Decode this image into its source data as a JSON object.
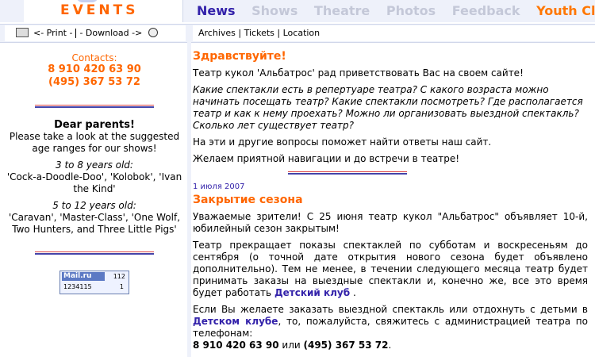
{
  "brand": {
    "title": "EVENTS"
  },
  "nav": {
    "news": "News",
    "shows": "Shows",
    "theatre": "Theatre",
    "photos": "Photos",
    "feedback": "Feedback",
    "youth_club": "Youth Club"
  },
  "toolbar": {
    "print": "<- Print -",
    "download": "- Download ->",
    "archives": "Archives",
    "tickets": "Tickets",
    "location": "Location",
    "sep": "|"
  },
  "sidebar": {
    "contacts_label": "Contacts:",
    "phone1": "8 910 420 63 90",
    "phone2": "(495) 367 53 72",
    "dear": "Dear parents!",
    "intro": "Please take a look at the suggested age ranges for our shows!",
    "age1": "3 to 8 years old:",
    "shows1": "'Cock-a-Doodle-Doo', 'Kolobok', 'Ivan the Kind'",
    "age2": "5 to 12 years old:",
    "shows2": "'Caravan', 'Master-Class', 'One Wolf, Two Hunters, and Three Little Pigs'",
    "counter_logo": "Mail.ru",
    "counter_n1": "112",
    "counter_n2": "1234115",
    "counter_n3": "1"
  },
  "main": {
    "greet_title": "Здравствуйте!",
    "greet_text": "Театр кукол 'Альбатрос' рад приветствовать Вас на своем сайте!",
    "questions": "Какие спектакли есть в репертуаре театра? С какого возраста можно начинать посещать театр? Какие спектакли посмотреть? Где располагается театр и как к нему проехать? Можно ли организовать выездной спектакль? Сколько лет существует театр?",
    "answers": "На эти и другие вопросы поможет найти ответы наш сайт.",
    "wish": "Желаем приятной навигации и до встречи в театре!",
    "news_date": "1 июля 2007",
    "news_title": "Закрытие сезона",
    "news_p1": "Уважаемые зрители! С 25 июня театр кукол \"Альбатрос\" объявляет 10-й, юбилейный сезон закрытым!",
    "news_p2_a": "Театр прекращает показы спектаклей по субботам и воскресеньям до сентября (о точной дате открытия нового сезона будет объявлено дополнительно). Тем не менее, в течении следующего месяца театр будет принимать заказы на выездные спектакли и, конечно же, все это время будет работать",
    "news_p2_link": "Детский клуб",
    "news_p2_end": ".",
    "news_p3_a": "Если Вы желаете заказать выездной спектакль или отдохнуть с детьми в",
    "news_p3_link": "Детском клубе",
    "news_p3_b": ", то, пожалуйста, свяжитесь с администрацией театра по телефонам:",
    "news_phone1": "8 910 420 63 90",
    "news_or": "или",
    "news_phone2": "(495) 367 53 72",
    "news_phone_end": "."
  }
}
